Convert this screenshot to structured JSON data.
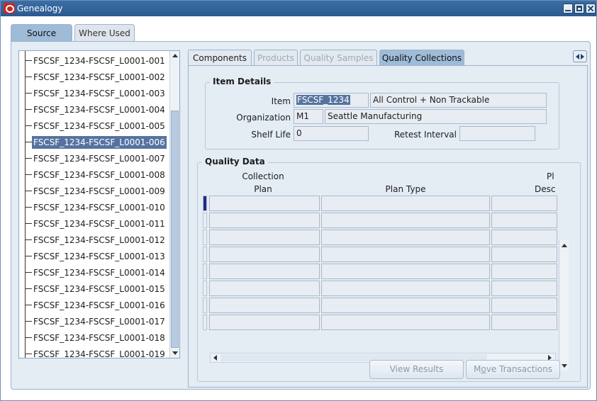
{
  "window": {
    "title": "Genealogy"
  },
  "outer_tabs": {
    "source": "Source",
    "where_used": "Where Used"
  },
  "tree": {
    "items": [
      "FSCSF_1234-FSCSF_L0001-001",
      "FSCSF_1234-FSCSF_L0001-002",
      "FSCSF_1234-FSCSF_L0001-003",
      "FSCSF_1234-FSCSF_L0001-004",
      "FSCSF_1234-FSCSF_L0001-005",
      "FSCSF_1234-FSCSF_L0001-006",
      "FSCSF_1234-FSCSF_L0001-007",
      "FSCSF_1234-FSCSF_L0001-008",
      "FSCSF_1234-FSCSF_L0001-009",
      "FSCSF_1234-FSCSF_L0001-010",
      "FSCSF_1234-FSCSF_L0001-011",
      "FSCSF_1234-FSCSF_L0001-012",
      "FSCSF_1234-FSCSF_L0001-013",
      "FSCSF_1234-FSCSF_L0001-014",
      "FSCSF_1234-FSCSF_L0001-015",
      "FSCSF_1234-FSCSF_L0001-016",
      "FSCSF_1234-FSCSF_L0001-017",
      "FSCSF_1234-FSCSF_L0001-018",
      "FSCSF_1234-FSCSF_L0001-019"
    ],
    "selected_item": "FSCSF_1234-FSCSF_L0001-006"
  },
  "inner_tabs": {
    "components": "Components",
    "products": "Products",
    "quality_samples": "Quality Samples",
    "quality_collections": "Quality Collections"
  },
  "item_details": {
    "title": "Item Details",
    "item_label": "Item",
    "item_value": "FSCSF_1234",
    "item_description": "All Control + Non Trackable",
    "organization_label": "Organization",
    "organization_code": "M1",
    "organization_name": "Seattle Manufacturing",
    "shelf_life_label": "Shelf Life",
    "shelf_life_value": "0",
    "retest_interval_label": "Retest Interval",
    "retest_interval_value": ""
  },
  "quality_data": {
    "title": "Quality Data",
    "col_plan_line1": "Collection",
    "col_plan_line2": "Plan",
    "col_plan_type": "Plan Type",
    "col_desc_line1": "Pl",
    "col_desc_line2": "Desc"
  },
  "buttons": {
    "view_results": "View Results",
    "move_prefix": "M",
    "move_mnemonic": "o",
    "move_suffix": "ve Transactions"
  },
  "colors": {
    "accent": "#9ebbd8",
    "selection": "#5673a0",
    "titlebar": "#2b5a90"
  }
}
